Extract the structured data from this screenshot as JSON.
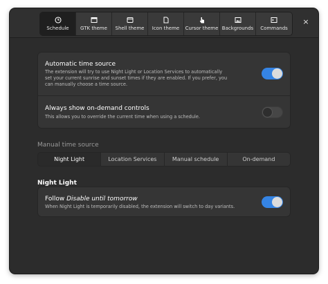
{
  "tabs": [
    {
      "label": "Schedule",
      "icon": "clock-icon",
      "active": true
    },
    {
      "label": "GTK theme",
      "icon": "window-icon",
      "active": false
    },
    {
      "label": "Shell theme",
      "icon": "shell-panel-icon",
      "active": false
    },
    {
      "label": "Icon theme",
      "icon": "file-icon",
      "active": false
    },
    {
      "label": "Cursor theme",
      "icon": "pointer-hand-icon",
      "active": false
    },
    {
      "label": "Backgrounds",
      "icon": "image-icon",
      "active": false
    },
    {
      "label": "Commands",
      "icon": "terminal-icon",
      "active": false
    }
  ],
  "close_glyph": "×",
  "time_source": {
    "auto_title": "Automatic time source",
    "auto_desc": "The extension will try to use Night Light or Location Services to automatically set your current sunrise and sunset times if they are enabled. If you prefer, you can manually choose a time source.",
    "auto_on": true,
    "ondemand_title": "Always show on-demand controls",
    "ondemand_desc": "This allows you to override the current time when using a schedule.",
    "ondemand_on": false
  },
  "manual": {
    "heading": "Manual time source",
    "options": [
      "Night Light",
      "Location Services",
      "Manual schedule",
      "On-demand"
    ],
    "selected": "Night Light"
  },
  "night_light": {
    "heading": "Night Light",
    "follow_prefix": "Follow ",
    "follow_emph": "Disable until tomorrow",
    "follow_desc": "When Night Light is temporarily disabled, the extension will switch to day variants.",
    "follow_on": true
  },
  "colors": {
    "accent": "#3584e4",
    "window_bg": "#2c2c2c",
    "card_bg": "#353535"
  }
}
